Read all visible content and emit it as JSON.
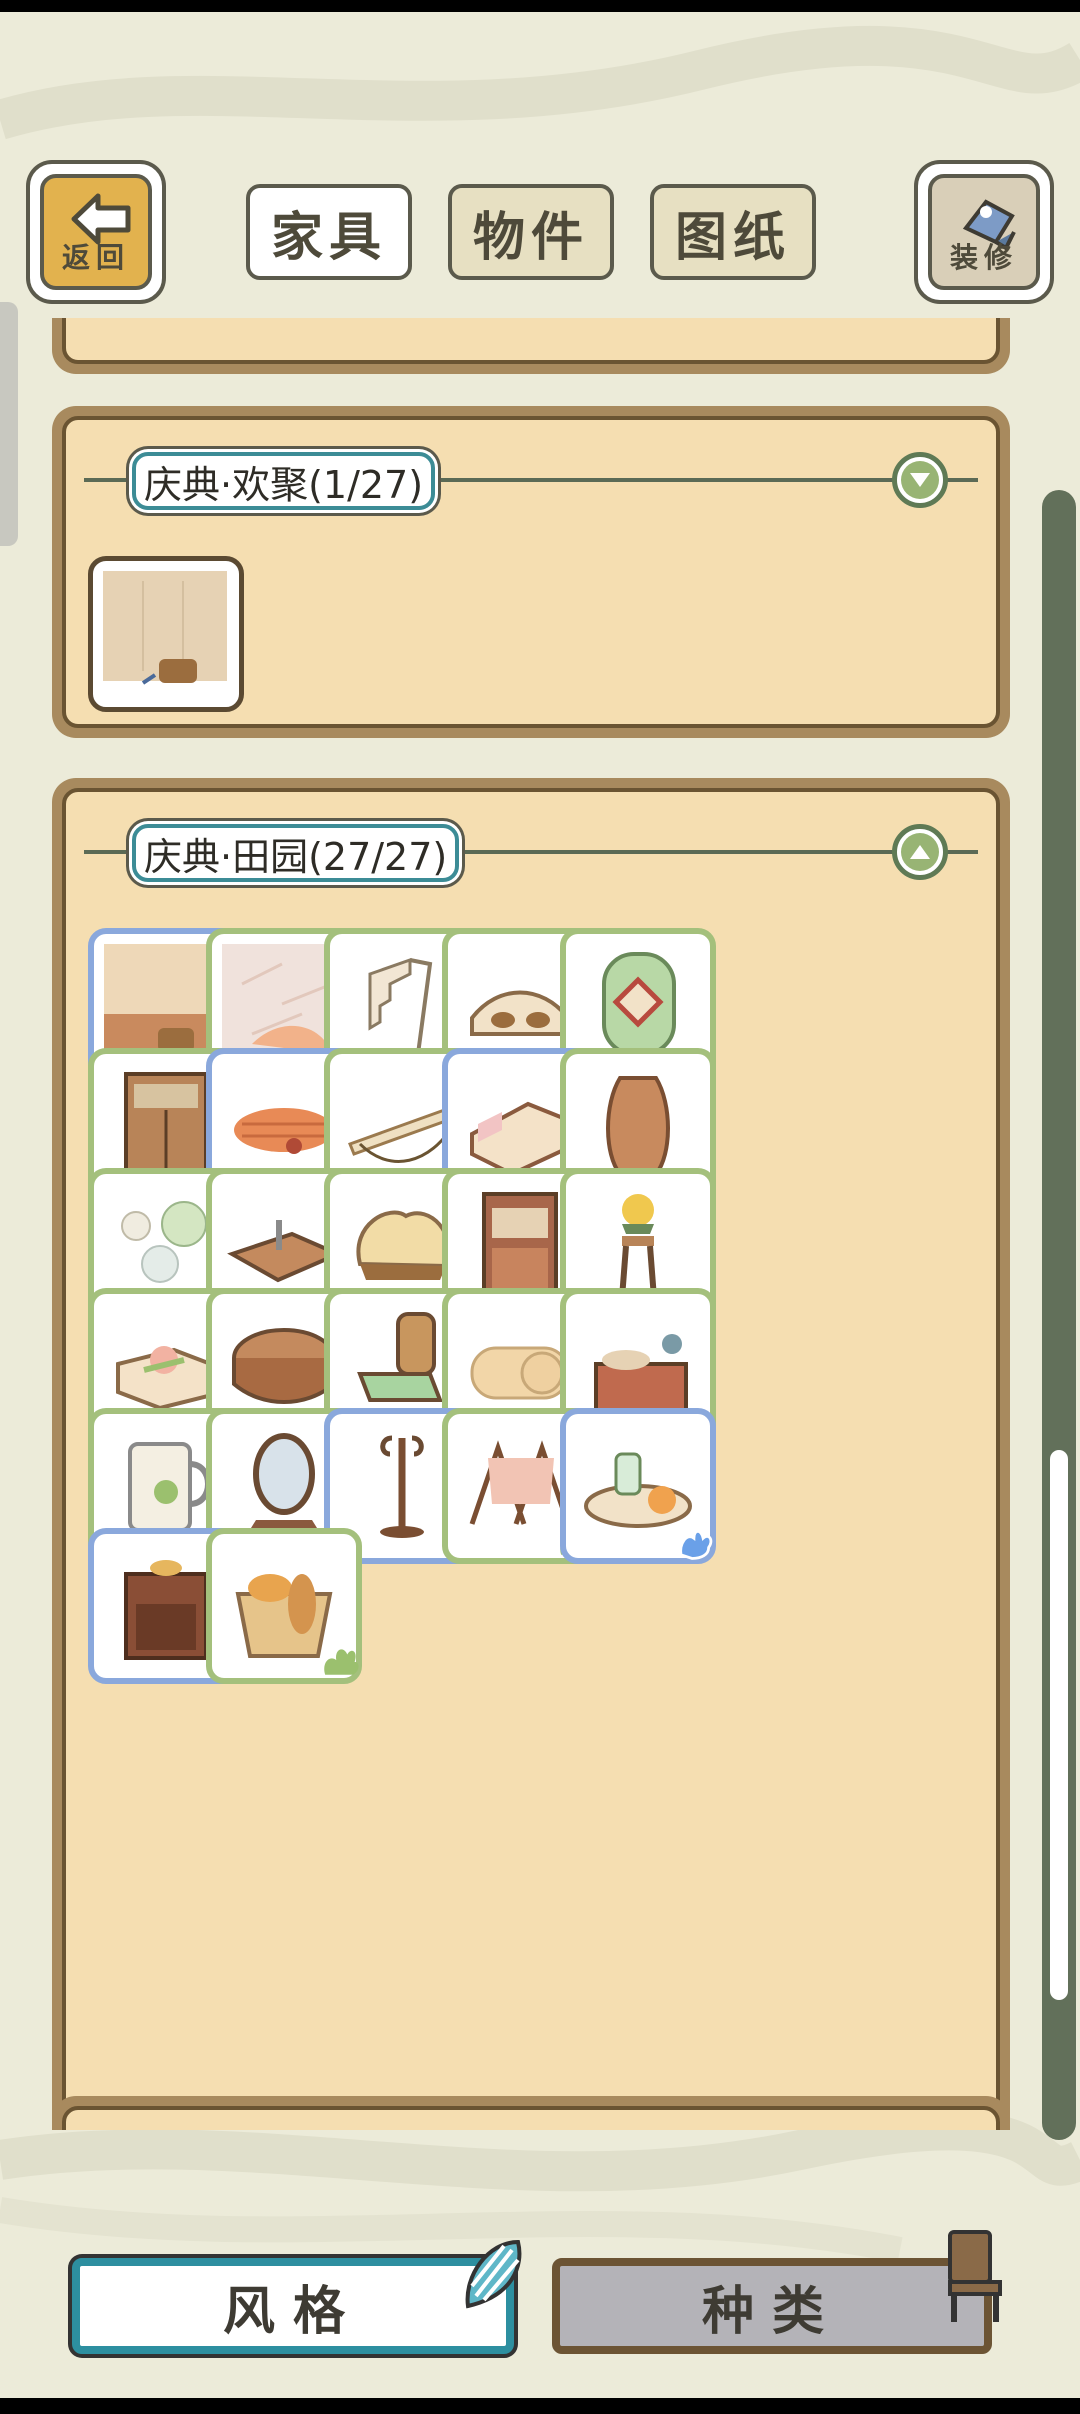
{
  "nav": {
    "back_label": "返回",
    "tabs": [
      {
        "label": "家具",
        "active": true
      },
      {
        "label": "物件",
        "active": false
      },
      {
        "label": "图纸",
        "active": false
      }
    ],
    "decorate_label": "装修"
  },
  "sections": [
    {
      "title": "庆典·欢聚(1/27)",
      "toggle": "expand-icon",
      "items": [
        {
          "style": "brown",
          "icon": "wall-bucket-icon"
        }
      ]
    },
    {
      "title": "庆典·田园(27/27)",
      "toggle": "collapse-icon",
      "items": [
        {
          "style": "blue",
          "icon": "wall-bucket-icon"
        },
        {
          "style": "green",
          "icon": "stone-floor-icon"
        },
        {
          "style": "green",
          "icon": "wooden-stairs-icon"
        },
        {
          "style": "green",
          "icon": "wooden-bridge-icon"
        },
        {
          "style": "green",
          "icon": "round-window-icon"
        },
        {
          "style": "green",
          "icon": "wardrobe-icon"
        },
        {
          "style": "blue",
          "icon": "woven-rug-icon"
        },
        {
          "style": "green",
          "icon": "loom-icon"
        },
        {
          "style": "blue",
          "icon": "bed-icon"
        },
        {
          "style": "green",
          "icon": "vase-icon"
        },
        {
          "style": "green",
          "icon": "stepping-stones-icon"
        },
        {
          "style": "green",
          "icon": "low-table-icon"
        },
        {
          "style": "green",
          "icon": "round-cushion-icon"
        },
        {
          "style": "green",
          "icon": "bookshelf-icon"
        },
        {
          "style": "green",
          "icon": "flower-stand-icon"
        },
        {
          "style": "green",
          "icon": "cake-box-icon"
        },
        {
          "style": "green",
          "icon": "round-table-icon"
        },
        {
          "style": "green",
          "icon": "chair-icon"
        },
        {
          "style": "green",
          "icon": "bedroll-icon"
        },
        {
          "style": "green",
          "icon": "kitchen-counter-icon"
        },
        {
          "style": "green",
          "icon": "mug-icon"
        },
        {
          "style": "green",
          "icon": "mirror-icon"
        },
        {
          "style": "blue",
          "icon": "coat-stand-icon"
        },
        {
          "style": "green",
          "icon": "clothes-rack-icon"
        },
        {
          "style": "blue",
          "icon": "candle-tray-icon"
        },
        {
          "style": "blue",
          "icon": "cabinet-icon"
        },
        {
          "style": "green",
          "icon": "bread-basket-icon"
        }
      ]
    }
  ],
  "bottom": {
    "style_label": "风格",
    "type_label": "种类"
  },
  "colors": {
    "bg": "#ecebd9",
    "panel": "#f5deb1",
    "green_frame": "#a4c07c",
    "blue_frame": "#8aa8dc",
    "accent_teal": "#2d8fa0"
  }
}
